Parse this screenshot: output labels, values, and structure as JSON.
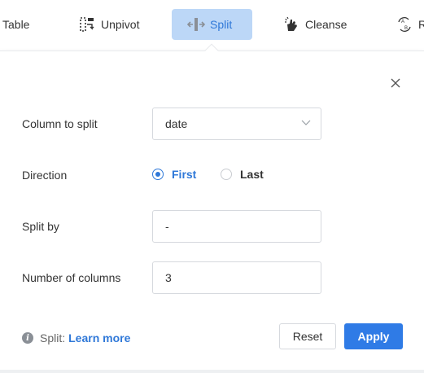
{
  "toolbar": {
    "items": [
      {
        "label": "Table",
        "icon": "table-icon"
      },
      {
        "label": "Unpivot",
        "icon": "unpivot-icon"
      },
      {
        "label": "Split",
        "icon": "split-icon",
        "active": true
      },
      {
        "label": "Cleanse",
        "icon": "cleanse-icon"
      },
      {
        "label": "R",
        "icon": "rename-icon"
      }
    ]
  },
  "split_panel": {
    "column_label": "Column to split",
    "column_value": "date",
    "direction_label": "Direction",
    "direction_options": [
      {
        "label": "First",
        "checked": true
      },
      {
        "label": "Last",
        "checked": false
      }
    ],
    "split_by_label": "Split by",
    "split_by_value": "-",
    "num_columns_label": "Number of columns",
    "num_columns_value": "3",
    "info_prefix": "Split:",
    "learn_more": "Learn more",
    "reset_label": "Reset",
    "apply_label": "Apply"
  },
  "colors": {
    "accent": "#2f78d8",
    "active_tab_bg": "#bcd7f7",
    "apply_bg": "#2f7be6"
  }
}
